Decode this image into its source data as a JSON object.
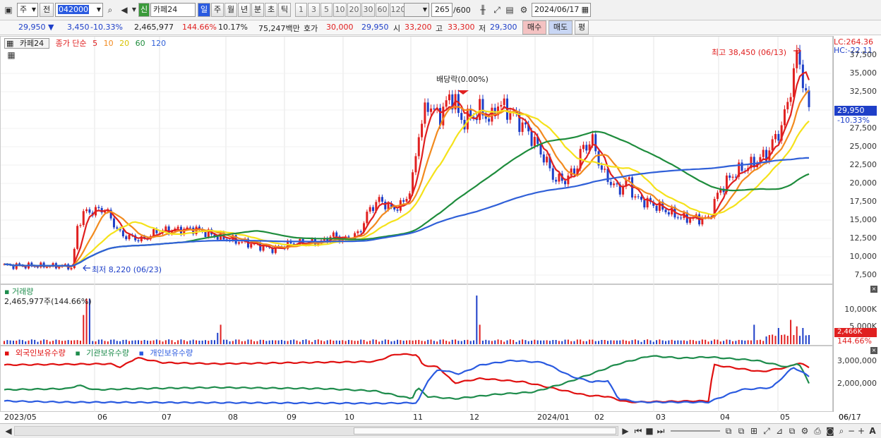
{
  "toolbar": {
    "period_select": "주",
    "prev_label": "전",
    "stock_code": "042000",
    "new_badge": "신",
    "stock_name": "카페24",
    "period_tabs": [
      "일",
      "주",
      "월",
      "년",
      "분",
      "초",
      "틱"
    ],
    "active_tab": "일",
    "interval_buttons": [
      "1",
      "3",
      "5",
      "10",
      "20",
      "30",
      "60",
      "120"
    ],
    "count_value": "265",
    "count_max": "/600",
    "date_value": "2024/06/17"
  },
  "quote": {
    "price": "29,950",
    "change": "3,450",
    "change_pct": "-10.33%",
    "volume": "2,465,977",
    "volume_ratio": "144.66%",
    "turnover": "10.17%",
    "amount": "75,247백만",
    "ask_label": "호가",
    "ask_value": "30,000",
    "bid_value": "29,950",
    "open_label": "시",
    "open_value": "33,200",
    "high_label": "고",
    "high_value": "33,300",
    "low_label": "저",
    "low_value": "29,300",
    "buy_button": "매수",
    "sell_button": "매도",
    "eval_button": "평"
  },
  "price_panel": {
    "stock_tag": "카페24",
    "legend_title": "종가 단순",
    "ma_periods": [
      "5",
      "10",
      "20",
      "60",
      "120"
    ],
    "lc_label": "LC:264.36",
    "hc_label": "HC:-22.11",
    "high_annotation": "최고 38,450 (06/13)",
    "low_annotation": "최저 8,220 (06/23)",
    "dividend_annotation": "배당락(0.00%)",
    "current_price": "29,950",
    "current_pct": "-10.33%",
    "y_ticks": [
      "37,500",
      "35,000",
      "32,500",
      "27,500",
      "25,000",
      "22,500",
      "20,000",
      "17,500",
      "15,000",
      "12,500",
      "10,000",
      "7,500"
    ]
  },
  "volume_panel": {
    "title": "거래량",
    "info": "2,465,977주(144.66%)",
    "y_ticks": [
      "10,000K",
      "5,000K"
    ],
    "current_value": "2,466K",
    "current_pct": "144.66%"
  },
  "holding_panel": {
    "legend": [
      "외국인보유수량",
      "기관보유수량",
      "개인보유수량"
    ],
    "y_ticks": [
      "3,000,000",
      "2,000,000"
    ]
  },
  "x_axis": [
    "2023/05",
    "06",
    "07",
    "08",
    "09",
    "10",
    "11",
    "12",
    "2024/01",
    "02",
    "03",
    "04",
    "05",
    "06",
    "06/17"
  ],
  "colors": {
    "up": "#e02020",
    "down": "#1e3fc8",
    "ma5": "#e02020",
    "ma10": "#f28a1e",
    "ma20": "#f5e21a",
    "ma60": "#1e8c3c",
    "ma120": "#3060d8",
    "foreign": "#e01010",
    "institution": "#1e8c4c",
    "individual": "#2a5ae0"
  }
}
